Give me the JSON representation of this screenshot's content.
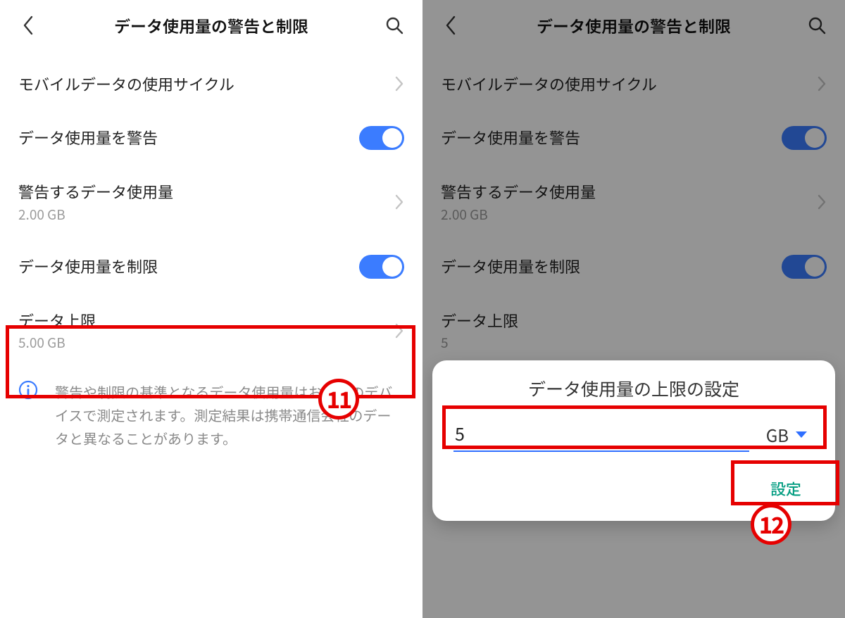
{
  "colors": {
    "accent": "#3b7cff",
    "highlight": "#e60000",
    "teal": "#059e82"
  },
  "left": {
    "header_title": "データ使用量の警告と制限",
    "rows": {
      "cycle": {
        "title": "モバイルデータの使用サイクル"
      },
      "warn_toggle": {
        "title": "データ使用量を警告",
        "on": true
      },
      "warn_amount": {
        "title": "警告するデータ使用量",
        "sub": "2.00 GB"
      },
      "limit_toggle": {
        "title": "データ使用量を制限",
        "on": true
      },
      "limit_amount": {
        "title": "データ上限",
        "sub": "5.00 GB"
      }
    },
    "info_text": "警告や制限の基準となるデータ使用量はお使いのデバイスで測定されます。測定結果は携帯通信会社のデータと異なることがあります。",
    "annotation": "11"
  },
  "right": {
    "header_title": "データ使用量の警告と制限",
    "rows": {
      "cycle": {
        "title": "モバイルデータの使用サイクル"
      },
      "warn_toggle": {
        "title": "データ使用量を警告",
        "on": true
      },
      "warn_amount": {
        "title": "警告するデータ使用量",
        "sub": "2.00 GB"
      },
      "limit_toggle": {
        "title": "データ使用量を制限",
        "on": true
      },
      "limit_amount": {
        "title": "データ上限",
        "sub_partial": "5"
      }
    },
    "dialog": {
      "title": "データ使用量の上限の設定",
      "value": "5",
      "unit": "GB",
      "confirm": "設定"
    },
    "annotation": "12"
  }
}
